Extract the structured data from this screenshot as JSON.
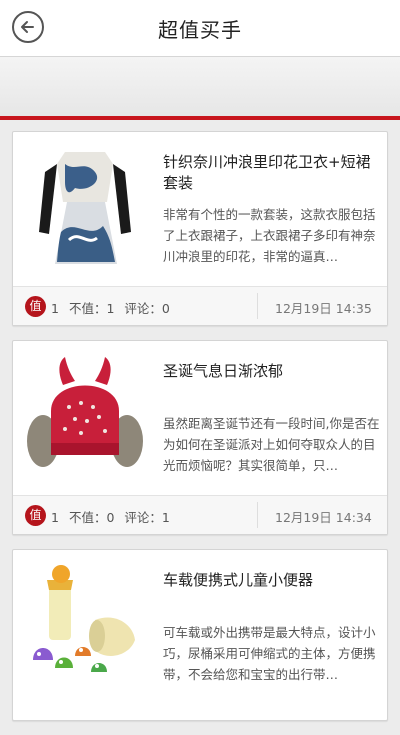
{
  "header": {
    "title": "超值买手",
    "back_icon": "back-arrow-icon"
  },
  "accent_color": "#c8161d",
  "items": [
    {
      "title": "针织奈川冲浪里印花卫衣+短裙套装",
      "desc": "非常有个性的一款套装，这款衣服包括了上衣跟裙子，上衣跟裙子多印有神奈川冲浪里的印花，非常的逼真…",
      "zhi_label": "值",
      "zhi_count": "1",
      "buzhi": "不值：1",
      "comments": "评论：0",
      "time": "12月19日 14:35"
    },
    {
      "title": "圣诞气息日渐浓郁",
      "desc": "虽然距离圣诞节还有一段时间,你是否在为如何在圣诞派对上如何夺取众人的目光而烦恼呢？其实很简单，只…",
      "zhi_label": "值",
      "zhi_count": "1",
      "buzhi": "不值：0",
      "comments": "评论：1",
      "time": "12月19日 14:34"
    },
    {
      "title": "车载便携式儿童小便器",
      "desc": "可车载或外出携带是最大特点，设计小巧，尿桶采用可伸缩式的主体，方便携带，不会给您和宝宝的出行带…"
    }
  ]
}
